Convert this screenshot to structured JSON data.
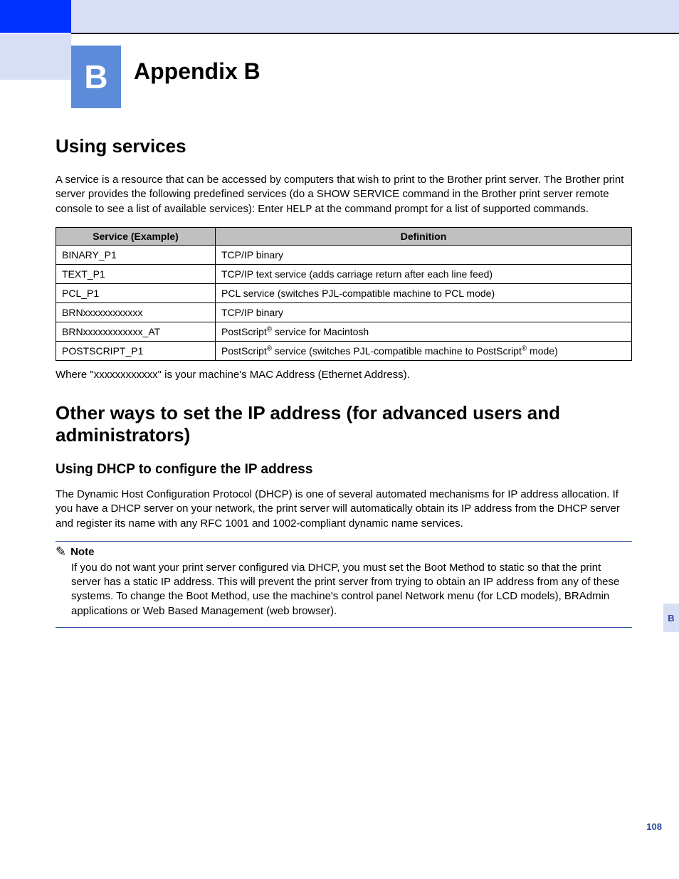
{
  "header": {
    "chapter_letter": "B",
    "chapter_title": "Appendix B"
  },
  "section1": {
    "title": "Using services",
    "intro_before_code": "A service is a resource that can be accessed by computers that wish to print to the Brother print server. The Brother print server provides the following predefined services (do a SHOW SERVICE command in the Brother print server remote console to see a list of available services): Enter ",
    "intro_code": "HELP",
    "intro_after_code": " at the command prompt for a list of supported commands."
  },
  "table": {
    "headers": {
      "col1": "Service (Example)",
      "col2": "Definition"
    },
    "rows": [
      {
        "service": "BINARY_P1",
        "def": "TCP/IP binary"
      },
      {
        "service": "TEXT_P1",
        "def": "TCP/IP text service (adds carriage return after each line feed)"
      },
      {
        "service": "PCL_P1",
        "def": "PCL service (switches PJL-compatible machine to PCL mode)"
      },
      {
        "service": "BRNxxxxxxxxxxxx",
        "def": "TCP/IP binary"
      },
      {
        "service": "BRNxxxxxxxxxxxx_AT",
        "def_pre": "PostScript",
        "def_sup1": "®",
        "def_post": " service for Macintosh"
      },
      {
        "service": "POSTSCRIPT_P1",
        "def_pre": "PostScript",
        "def_sup1": "®",
        "def_mid": " service (switches PJL-compatible machine to PostScript",
        "def_sup2": "®",
        "def_post": " mode)"
      }
    ]
  },
  "table_footnote": "Where \"xxxxxxxxxxxx\" is your machine's MAC Address (Ethernet Address).",
  "section2": {
    "title": "Other ways to set the IP address (for advanced users and administrators)",
    "sub1": {
      "title": "Using DHCP to configure the IP address",
      "para": "The Dynamic Host Configuration Protocol (DHCP) is one of several automated mechanisms for IP address allocation. If you have a DHCP server on your network, the print server will automatically obtain its IP address from the DHCP server and register its name with any RFC 1001 and 1002-compliant dynamic name services."
    }
  },
  "note": {
    "label": "Note",
    "body": "If you do not want your print server configured via DHCP, you must set the Boot Method to static so that the print server has a static IP address. This will prevent the print server from trying to obtain an IP address from any of these systems. To change the Boot Method, use the machine's control panel Network menu (for LCD models), BRAdmin applications or Web Based Management (web browser)."
  },
  "page_number": "108",
  "side_tab": "B"
}
